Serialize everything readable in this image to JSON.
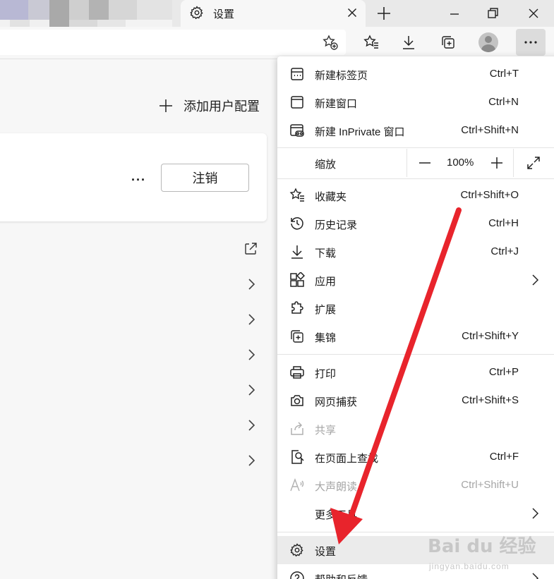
{
  "tab": {
    "title": "设置"
  },
  "page": {
    "add_profile_label": "添加用户配置",
    "more_label": "···",
    "signout_label": "注销"
  },
  "menu": {
    "items": [
      {
        "label": "新建标签页",
        "shortcut": "Ctrl+T",
        "icon": "new-tab-icon"
      },
      {
        "label": "新建窗口",
        "shortcut": "Ctrl+N",
        "icon": "new-window-icon"
      },
      {
        "label": "新建 InPrivate 窗口",
        "shortcut": "Ctrl+Shift+N",
        "icon": "inprivate-icon"
      },
      {
        "label": "收藏夹",
        "shortcut": "Ctrl+Shift+O",
        "icon": "favorites-icon"
      },
      {
        "label": "历史记录",
        "shortcut": "Ctrl+H",
        "icon": "history-icon"
      },
      {
        "label": "下载",
        "shortcut": "Ctrl+J",
        "icon": "download-icon"
      },
      {
        "label": "应用",
        "shortcut": "",
        "icon": "apps-icon"
      },
      {
        "label": "扩展",
        "shortcut": "",
        "icon": "extensions-icon"
      },
      {
        "label": "集锦",
        "shortcut": "Ctrl+Shift+Y",
        "icon": "collections-icon"
      },
      {
        "label": "打印",
        "shortcut": "Ctrl+P",
        "icon": "print-icon"
      },
      {
        "label": "网页捕获",
        "shortcut": "Ctrl+Shift+S",
        "icon": "web-capture-icon"
      },
      {
        "label": "共享",
        "shortcut": "",
        "icon": "share-icon"
      },
      {
        "label": "在页面上查找",
        "shortcut": "Ctrl+F",
        "icon": "find-icon"
      },
      {
        "label": "大声朗读",
        "shortcut": "Ctrl+Shift+U",
        "icon": "read-aloud-icon"
      },
      {
        "label": "更多工具",
        "shortcut": "",
        "icon": ""
      },
      {
        "label": "设置",
        "shortcut": "",
        "icon": "gear-icon"
      },
      {
        "label": "帮助和反馈",
        "shortcut": "",
        "icon": "help-icon"
      }
    ],
    "zoom": {
      "label": "缩放",
      "value": "100%"
    }
  },
  "watermark": {
    "main": "Bai du 经验",
    "sub": "jingyan.baidu.com"
  },
  "colors": {
    "arrow": "#e8242c",
    "menu_highlight": "#ebebeb"
  }
}
